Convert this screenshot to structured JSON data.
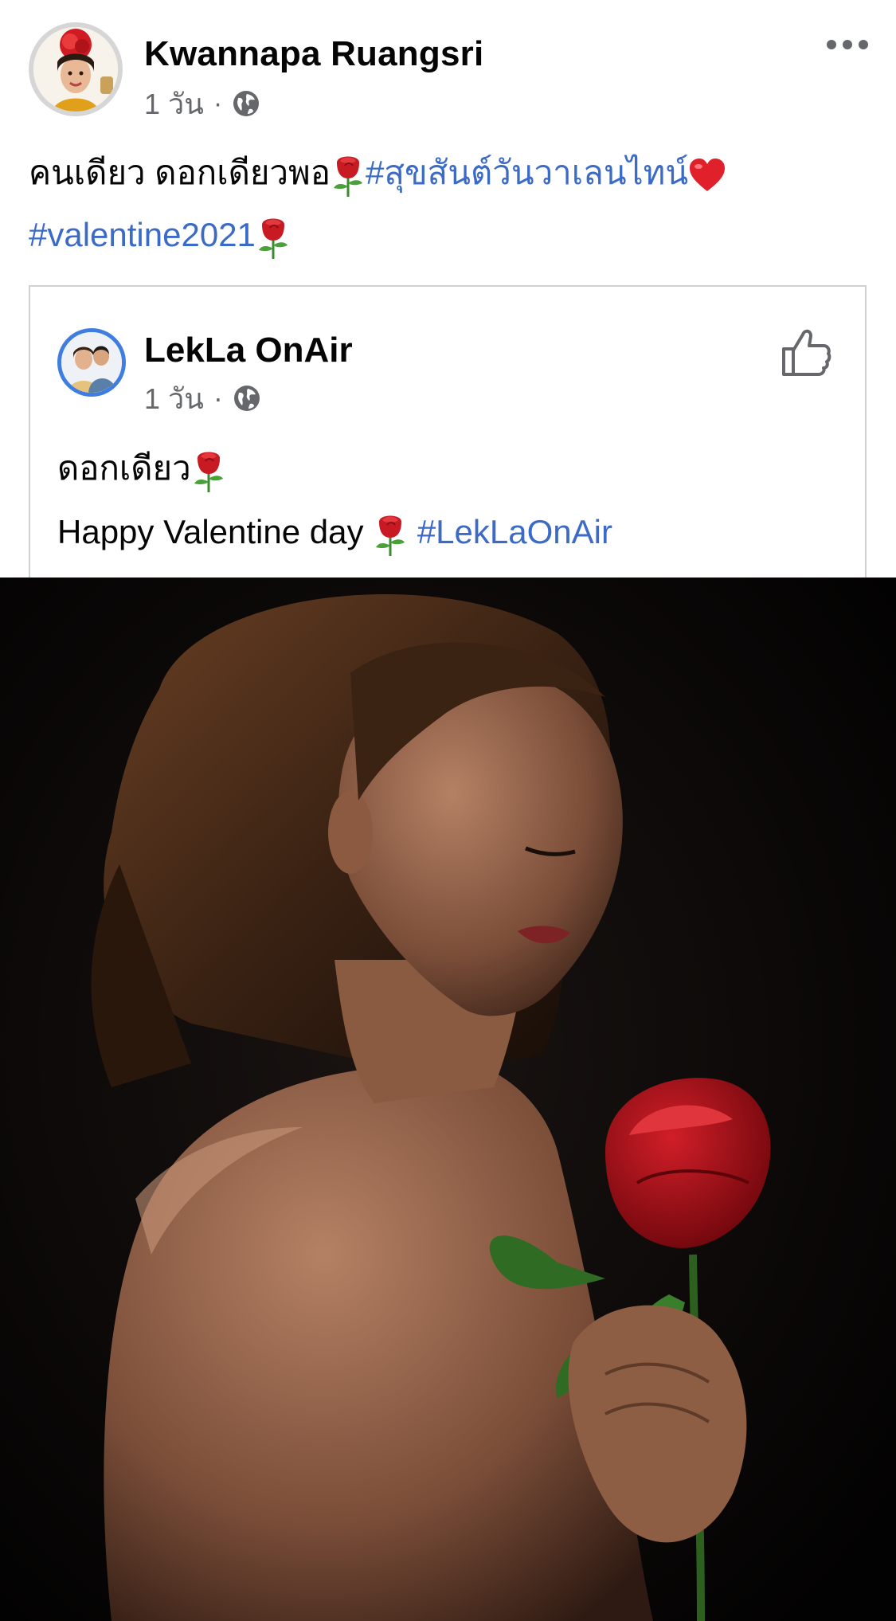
{
  "post": {
    "author_name": "Kwannapa Ruangsri",
    "time": "1 วัน",
    "separator": "·",
    "privacy_icon": "globe-icon",
    "menu_icon": "more-dots-icon",
    "text_line1": "คนเดียว ดอกเดียวพอ",
    "hashtag1": "#สุขสันต์วันวาเลนไทน์",
    "hashtag2": "#valentine2021",
    "emoji_rose": "rose-emoji",
    "emoji_heart": "red-heart-emoji"
  },
  "shared_post": {
    "author_name": "LekLa OnAir",
    "time": "1 วัน",
    "separator": "·",
    "privacy_icon": "globe-icon",
    "like_icon": "thumbs-up-icon",
    "text_line1": "ดอกเดียว",
    "text_line2": "Happy Valentine day",
    "hashtag": "#LekLaOnAir"
  },
  "colors": {
    "hashtag": "#3b6bc6",
    "secondary_text": "#65676b",
    "shared_avatar_ring": "#3f7ee0",
    "card_border": "#cfd1d5",
    "photo_background": "#040303",
    "rose": "#b5121b"
  }
}
